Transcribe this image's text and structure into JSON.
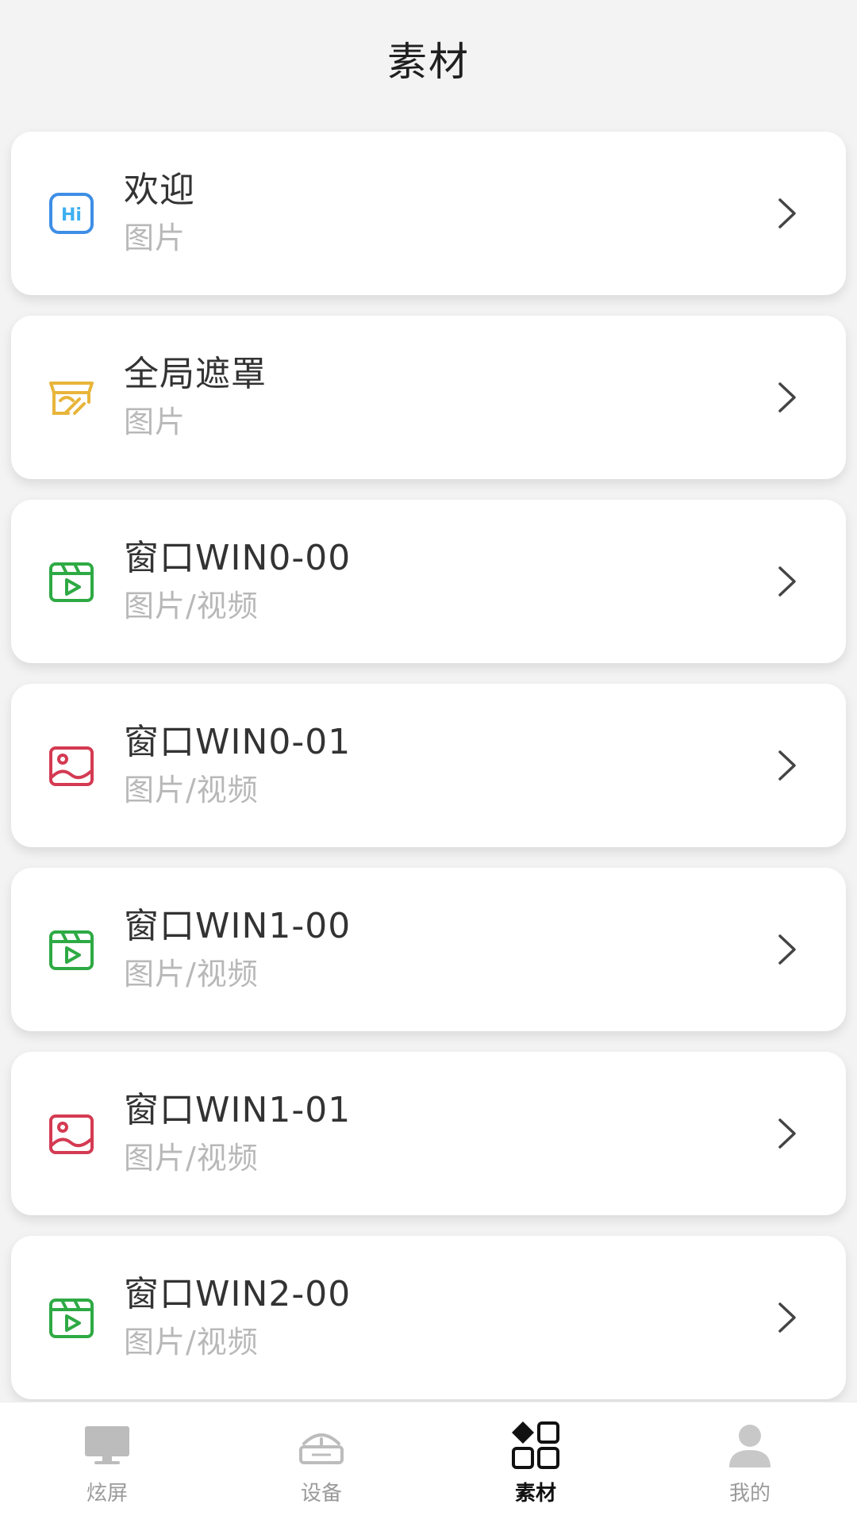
{
  "header": {
    "title": "素材"
  },
  "items": [
    {
      "title": "欢迎",
      "subtitle": "图片",
      "icon": "hi-icon",
      "color": "#3e8ee6"
    },
    {
      "title": "全局遮罩",
      "subtitle": "图片",
      "icon": "mask-icon",
      "color": "#e8b53a"
    },
    {
      "title": "窗口WIN0-00",
      "subtitle": "图片/视频",
      "icon": "video-icon",
      "color": "#2eaa44"
    },
    {
      "title": "窗口WIN0-01",
      "subtitle": "图片/视频",
      "icon": "image-icon",
      "color": "#d43a52"
    },
    {
      "title": "窗口WIN1-00",
      "subtitle": "图片/视频",
      "icon": "video-icon",
      "color": "#2eaa44"
    },
    {
      "title": "窗口WIN1-01",
      "subtitle": "图片/视频",
      "icon": "image-icon",
      "color": "#d43a52"
    },
    {
      "title": "窗口WIN2-00",
      "subtitle": "图片/视频",
      "icon": "video-icon",
      "color": "#2eaa44"
    }
  ],
  "bottom_nav": [
    {
      "label": "炫屏",
      "icon": "monitor-icon",
      "active": false
    },
    {
      "label": "设备",
      "icon": "device-icon",
      "active": false
    },
    {
      "label": "素材",
      "icon": "materials-icon",
      "active": true
    },
    {
      "label": "我的",
      "icon": "user-icon",
      "active": false
    }
  ]
}
